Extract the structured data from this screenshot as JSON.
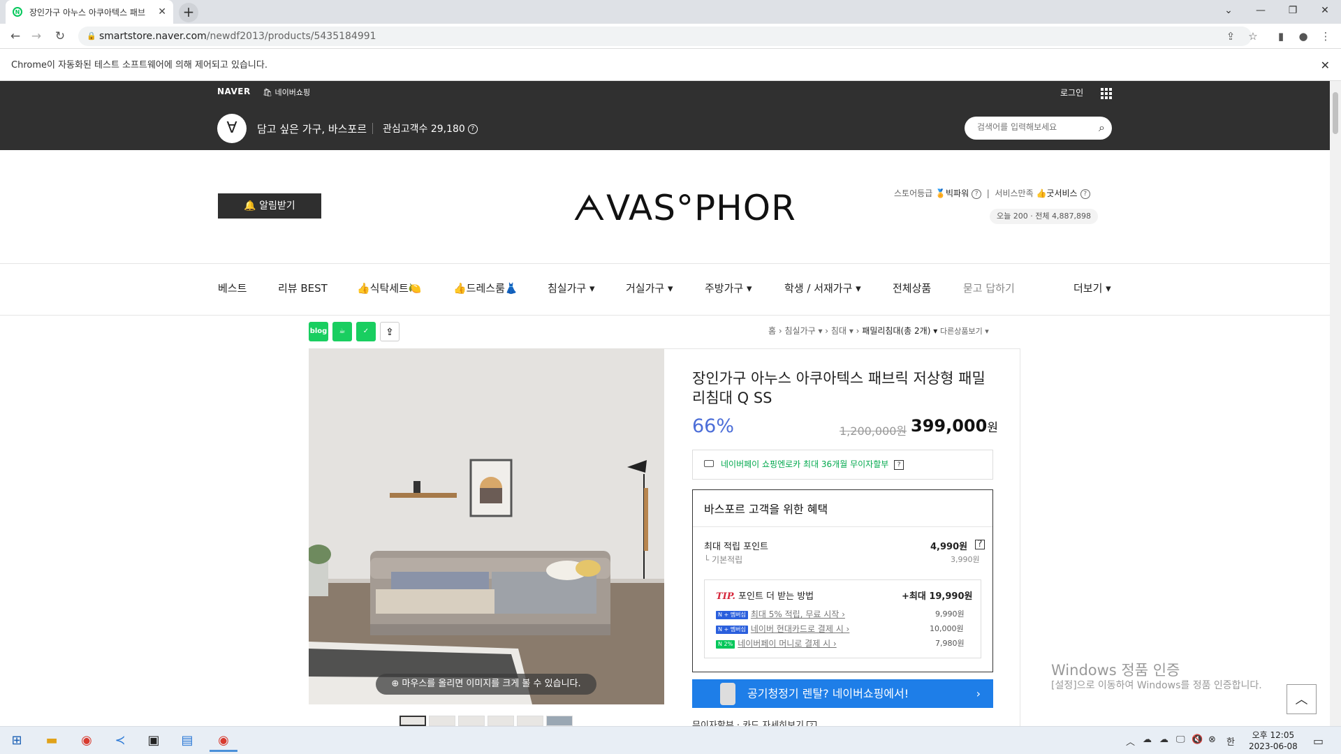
{
  "browser": {
    "tab_title": "장인가구 아누스 아쿠아텍스 패브",
    "tab_close": "✕",
    "new_tab": "+",
    "url_host": "smartstore.naver.com",
    "url_path": "/newdf2013/products/5435184991",
    "infobar_text": "Chrome이 자동화된 테스트 소프트웨어에 의해 제어되고 있습니다.",
    "infobar_close": "✕"
  },
  "top": {
    "naver": "NAVER",
    "naver_shopping": "네이버쇼핑",
    "login": "로그인",
    "store_logo_glyph": "∀",
    "store_name": "담고 싶은 가구, 바스포르",
    "interest": "관심고객수 29,180",
    "search_placeholder": "검색어를 입력해보세요"
  },
  "header": {
    "alarm_button": "알림받기",
    "brand": "ᗅVAS°PHOR",
    "store_grade_label": "스토어등급",
    "store_grade": "빅파워",
    "service_label": "서비스만족",
    "service": "굿서비스",
    "visits": "오늘 200 · 전체 4,887,898"
  },
  "menu": [
    "베스트",
    "리뷰 BEST",
    "👍식탁세트🍋",
    "👍드레스룸👗",
    "침실가구 ▾",
    "거실가구 ▾",
    "주방가구 ▾",
    "학생 / 서재가구 ▾",
    "전체상품",
    "묻고 답하기",
    "더보기 ▾"
  ],
  "share_icons": [
    "blog",
    "cafe",
    "band",
    "share"
  ],
  "breadcrumb": {
    "home": "홈",
    "cat1": "침실가구 ▾",
    "cat2": "침대 ▾",
    "cat3": "패밀리침대(총 2개) ▾",
    "other": "다른상품보기 ▾"
  },
  "product": {
    "title": "장인가구 아누스 아쿠아텍스 패브릭 저상형 패밀리침대 Q SS",
    "discount": "66%",
    "original_price": "1,200,000원",
    "price": "399,000",
    "price_unit": "원",
    "zoom_tip": "마우스를 올리면 이미지를 크게 볼 수 있습니다.",
    "npay_text": "네이버페이 쇼핑엔로카 최대 36개월 무이자할부",
    "benefit_title": "바스포르 고객을 위한 혜택",
    "max_point_label": "최대 적립 포인트",
    "max_point": "4,990원",
    "basic_point_label": "기본적립",
    "basic_point": "3,990원",
    "tip_label": "TIP.",
    "tip_title": "포인트 더 받는 방법",
    "tip_max": "+최대 19,990원",
    "tips": [
      {
        "badge": "N + 멤버십",
        "text": "최대 5% 적립, 무료 시작 ›",
        "value": "9,990원"
      },
      {
        "badge": "N + 멤버십",
        "text": "네이버 현대카드로 결제 시 ›",
        "value": "10,000원"
      },
      {
        "badge": "N 2%",
        "text": "네이버페이 머니로 결제 시 ›",
        "value": "7,980원"
      }
    ],
    "rental_banner": "공기청정기 렌탈? 네이버쇼핑에서!",
    "more_info": "무이자할부 · 카드 자세히보기"
  },
  "windows_watermark": {
    "line1": "Windows 정품 인증",
    "line2": "[설정]으로 이동하여 Windows를 정품 인증합니다."
  },
  "taskbar": {
    "ime": "한",
    "time": "오후 12:05",
    "date": "2023-06-08"
  }
}
